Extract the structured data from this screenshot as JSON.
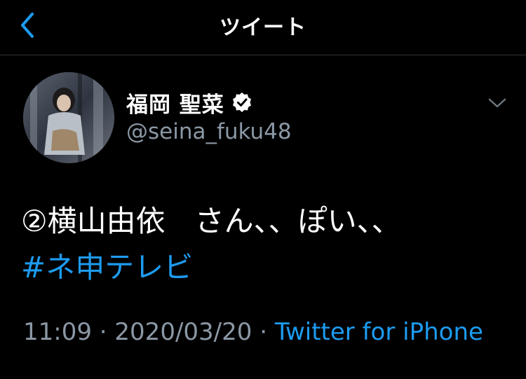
{
  "header": {
    "title": "ツイート",
    "back_icon": "chevron-left-icon"
  },
  "tweet": {
    "display_name": "福岡 聖菜",
    "handle": "@seina_fuku48",
    "verified_icon": "verified-badge-icon",
    "more_icon": "chevron-down-icon",
    "text": "②横山由依　さん、、ぽい、、",
    "hashtag": "#ネ申テレビ",
    "time": "11:09",
    "separator": " · ",
    "date": "2020/03/20",
    "source": "Twitter for iPhone"
  },
  "colors": {
    "background": "#000000",
    "text": "#ffffff",
    "secondary": "#8b98a5",
    "accent": "#1d9bf0",
    "divider": "#2f3336"
  }
}
